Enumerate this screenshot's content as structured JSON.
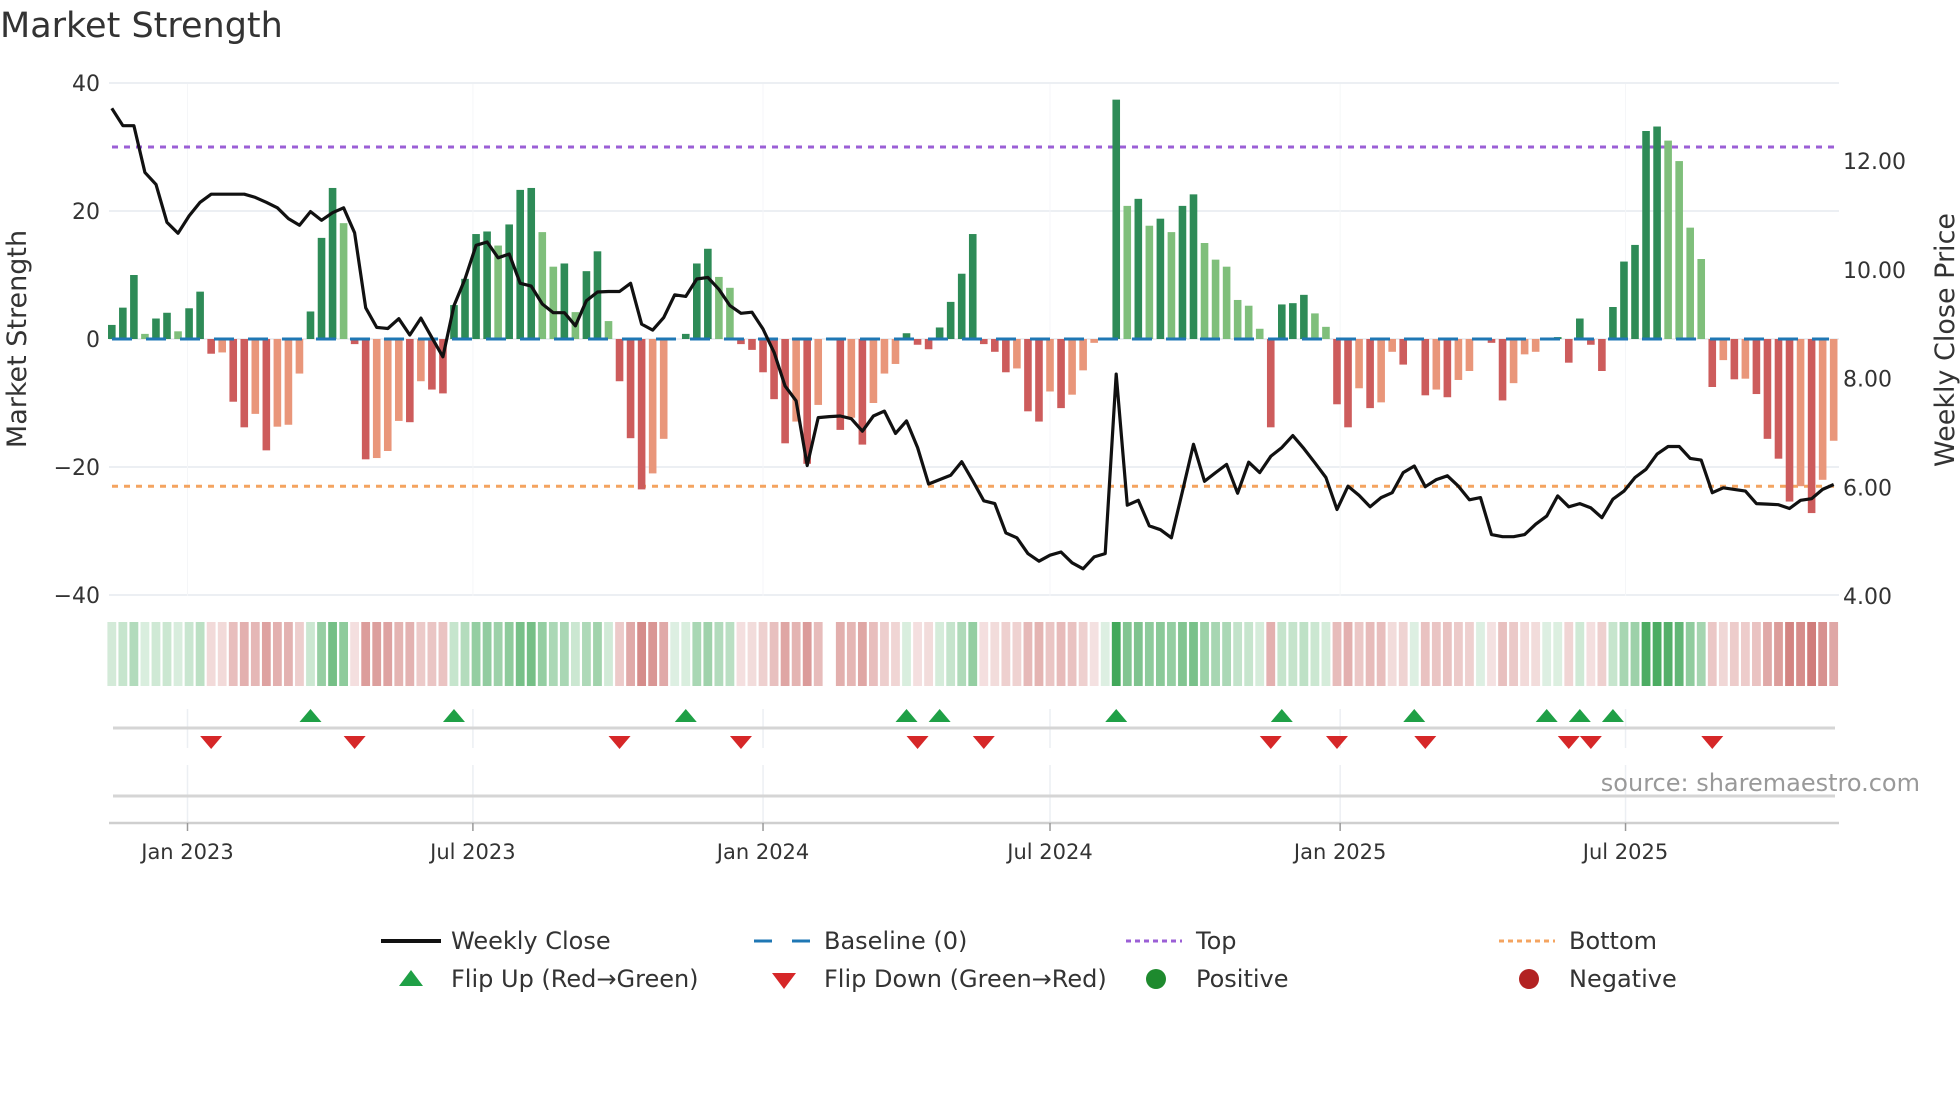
{
  "title": "Market Strength",
  "source": "source: sharemaestro.com",
  "legend": {
    "weekly_close": "Weekly Close",
    "baseline": "Baseline (0)",
    "top": "Top",
    "bottom": "Bottom",
    "flip_up": "Flip Up (Red→Green)",
    "flip_down": "Flip Down (Green→Red)",
    "positive": "Positive",
    "negative": "Negative"
  },
  "chart_data": {
    "type": "bar",
    "title": "Market Strength",
    "frequency": "weekly",
    "start_date": "2022-11-14",
    "ylabel": "Market Strength",
    "ylabel_right": "Weekly Close Price",
    "ylim": [
      -40,
      40
    ],
    "ylim_right": [
      4,
      13.4
    ],
    "yticks": [
      {
        "v": 40,
        "label": "40"
      },
      {
        "v": 20,
        "label": "20"
      },
      {
        "v": 0,
        "label": "0"
      },
      {
        "v": -20,
        "label": "−20"
      },
      {
        "v": -40,
        "label": "−40"
      }
    ],
    "yticks_right": [
      {
        "v": 12,
        "label": "12.00"
      },
      {
        "v": 10,
        "label": "10.00"
      },
      {
        "v": 8,
        "label": "8.00"
      },
      {
        "v": 6,
        "label": "6.00"
      },
      {
        "v": 4,
        "label": "4.00"
      }
    ],
    "xticks": [
      {
        "date": "2023-01-01",
        "label": "Jan 2023"
      },
      {
        "date": "2023-07-01",
        "label": "Jul 2023"
      },
      {
        "date": "2024-01-01",
        "label": "Jan 2024"
      },
      {
        "date": "2024-07-01",
        "label": "Jul 2024"
      },
      {
        "date": "2025-01-01",
        "label": "Jan 2025"
      },
      {
        "date": "2025-07-01",
        "label": "Jul 2025"
      }
    ],
    "top_level": 30,
    "bottom_level": -23,
    "baseline": 0,
    "strength": [
      2.2,
      4.9,
      10,
      0.8,
      3.2,
      4.1,
      1.2,
      4.8,
      7.4,
      -2.3,
      -2.1,
      -9.8,
      -13.8,
      -11.7,
      -17.4,
      -13.7,
      -13.4,
      -5.4,
      4.3,
      15.8,
      23.6,
      18.1,
      -0.8,
      -18.8,
      -18.6,
      -17.5,
      -12.8,
      -13,
      -6.6,
      -7.9,
      -8.5,
      5.3,
      9.4,
      16.4,
      16.8,
      14.6,
      17.9,
      23.3,
      23.6,
      16.7,
      11.3,
      11.8,
      4.2,
      10.6,
      13.7,
      2.8,
      -6.6,
      -15.5,
      -23.5,
      -21,
      -15.6,
      0,
      0.8,
      11.8,
      14.1,
      9.7,
      8,
      -0.8,
      -1.7,
      -5.2,
      -9.4,
      -16.3,
      -12.9,
      -19.5,
      -10.3,
      null,
      -14.2,
      -12.3,
      -16.5,
      -10,
      -5.4,
      -3.9,
      0.9,
      -0.9,
      -1.6,
      1.8,
      5.8,
      10.2,
      16.4,
      -0.8,
      -2,
      -5.2,
      -4.6,
      -11.3,
      -12.9,
      -8.2,
      -10.8,
      -8.7,
      -4.9,
      -0.6,
      0,
      37.4,
      20.8,
      21.9,
      17.7,
      18.8,
      16.7,
      20.8,
      22.6,
      15,
      12.4,
      11.3,
      6.1,
      5.2,
      1.6,
      -13.8,
      5.4,
      5.6,
      6.9,
      4,
      1.9,
      -10.2,
      -13.8,
      -7.7,
      -10.8,
      -9.9,
      -2,
      -4,
      0,
      -8.8,
      -7.9,
      -9.1,
      -6.4,
      -5,
      0,
      -0.6,
      -9.6,
      -6.9,
      -2.4,
      -2,
      0,
      0.3,
      -3.7,
      3.2,
      -0.9,
      -5,
      5,
      12.1,
      14.7,
      32.5,
      33.2,
      31,
      27.8,
      17.4,
      12.5,
      -7.5,
      -3.3,
      -6.3,
      -6.2,
      -8.6,
      -15.6,
      -18.7,
      -25.4,
      -23,
      -27.2,
      -22,
      -15.9
    ],
    "close": [
      12.97,
      12.65,
      12.65,
      11.79,
      11.57,
      10.87,
      10.67,
      10.99,
      11.24,
      11.39,
      11.39,
      11.39,
      11.39,
      11.33,
      11.24,
      11.14,
      10.94,
      10.82,
      11.07,
      10.91,
      11.05,
      11.14,
      10.68,
      9.3,
      8.94,
      8.92,
      9.1,
      8.8,
      9.11,
      8.75,
      8.4,
      9.34,
      9.83,
      10.45,
      10.51,
      10.22,
      10.29,
      9.75,
      9.7,
      9.37,
      9.21,
      9.21,
      8.97,
      9.43,
      9.59,
      9.6,
      9.6,
      9.75,
      9,
      8.89,
      9.12,
      9.54,
      9.51,
      9.83,
      9.86,
      9.64,
      9.34,
      9.2,
      9.22,
      8.91,
      8.48,
      7.86,
      7.59,
      6.4,
      7.28,
      7.3,
      7.31,
      7.26,
      7.03,
      7.31,
      7.4,
      6.99,
      7.22,
      6.73,
      6.06,
      6.14,
      6.22,
      6.47,
      6.12,
      5.75,
      5.7,
      5.16,
      5.07,
      4.78,
      4.64,
      4.75,
      4.81,
      4.61,
      4.5,
      4.72,
      4.78,
      8.08,
      5.67,
      5.76,
      5.29,
      5.22,
      5.07,
      5.93,
      6.79,
      6.11,
      6.27,
      6.42,
      5.89,
      6.46,
      6.27,
      6.57,
      6.73,
      6.95,
      6.71,
      6.45,
      6.18,
      5.59,
      6.02,
      5.85,
      5.64,
      5.81,
      5.9,
      6.27,
      6.39,
      6.01,
      6.14,
      6.21,
      6.02,
      5.77,
      5.81,
      5.13,
      5.09,
      5.09,
      5.13,
      5.32,
      5.47,
      5.84,
      5.64,
      5.7,
      5.62,
      5.44,
      5.78,
      5.93,
      6.18,
      6.33,
      6.61,
      6.75,
      6.75,
      6.53,
      6.5,
      5.9,
      5.99,
      5.96,
      5.93,
      5.7,
      5.69,
      5.68,
      5.61,
      5.76,
      5.79,
      5.96,
      6.05
    ],
    "flip_up": [
      "2023-03-20",
      "2023-06-19",
      "2023-11-13",
      "2024-04-01",
      "2024-04-22",
      "2024-08-12",
      "2024-11-25",
      "2025-02-17",
      "2025-05-12",
      "2025-06-02",
      "2025-06-23"
    ],
    "flip_down": [
      "2023-01-16",
      "2023-04-17",
      "2023-10-02",
      "2023-12-18",
      "2024-04-08",
      "2024-05-20",
      "2024-11-18",
      "2024-12-30",
      "2025-02-24",
      "2025-05-26",
      "2025-06-09",
      "2025-08-25"
    ],
    "grid": true,
    "legend_position": "bottom",
    "colors": {
      "pos_strong": "#2e8b57",
      "pos_weak": "#7fbf7b",
      "neg_strong": "#cd5c5c",
      "neg_weak": "#e9967a",
      "top": "#9b5fd6",
      "bottom": "#f4a460",
      "baseline": "#1f77b4",
      "close": "#111111",
      "flip_up": "#1fa046",
      "flip_down": "#d62728",
      "positive": "#1e8a2e",
      "negative": "#b22222",
      "heat_pos": "#2e9e48",
      "heat_neg": "#c0504d"
    }
  }
}
